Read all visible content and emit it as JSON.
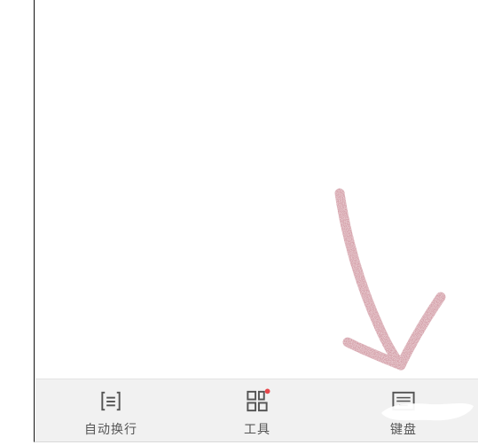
{
  "toolbar": {
    "items": [
      {
        "label": "自动换行",
        "icon": "wrap-text-icon"
      },
      {
        "label": "工具",
        "icon": "grid-tools-icon",
        "has_badge": true
      },
      {
        "label": "键盘",
        "icon": "keyboard-icon"
      }
    ]
  },
  "colors": {
    "toolbar_bg": "#f1f1f1",
    "icon": "#555555",
    "badge": "#e8474c",
    "annotation_arrow": "#b55a6a"
  }
}
